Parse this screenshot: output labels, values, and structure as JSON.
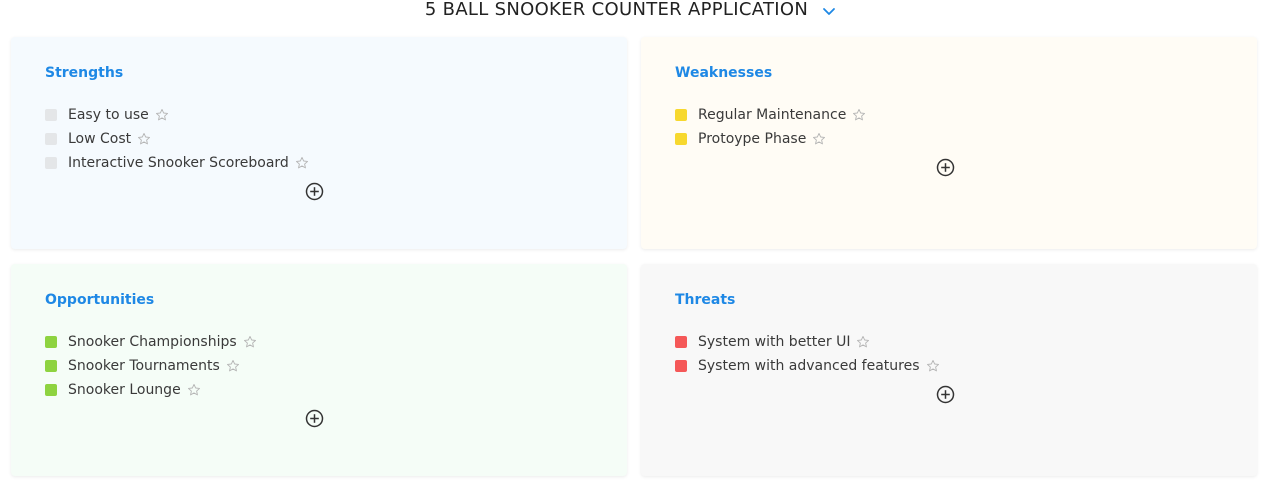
{
  "page": {
    "title": "5 BALL SNOOKER COUNTER APPLICATION"
  },
  "colors": {
    "heading": "#1e88e5",
    "strengths_bg": "#f5fafe",
    "weaknesses_bg": "#fffcf5",
    "opportunities_bg": "#f5fdf7",
    "threats_bg": "#f8f8f8",
    "strengths_marker": "#e4e6e8",
    "weaknesses_marker": "#f7d82e",
    "opportunities_marker": "#8ed340",
    "threats_marker": "#f55858"
  },
  "quadrants": {
    "strengths": {
      "title": "Strengths",
      "items": [
        "Easy to use",
        "Low Cost",
        "Interactive Snooker Scoreboard"
      ]
    },
    "weaknesses": {
      "title": "Weaknesses",
      "items": [
        "Regular Maintenance",
        "Protoype Phase"
      ]
    },
    "opportunities": {
      "title": "Opportunities",
      "items": [
        "Snooker Championships",
        "Snooker Tournaments",
        "Snooker Lounge"
      ]
    },
    "threats": {
      "title": "Threats",
      "items": [
        "System with better UI",
        "System with advanced features"
      ]
    }
  },
  "icons": {
    "header": "chevron-down-icon",
    "item": "star-outline-icon",
    "add": "plus-circle-icon"
  }
}
